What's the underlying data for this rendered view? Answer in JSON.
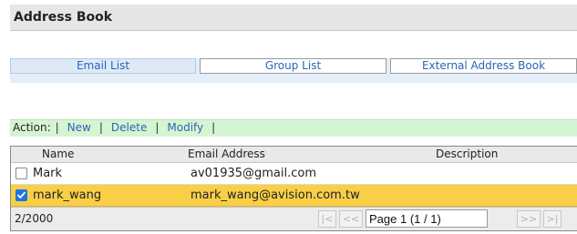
{
  "window": {
    "title": "Address Book"
  },
  "tabs": [
    {
      "label": "Email List",
      "active": true
    },
    {
      "label": "Group List",
      "active": false
    },
    {
      "label": "External Address Book",
      "active": false
    }
  ],
  "actions": {
    "label": "Action:",
    "new_label": "New",
    "delete_label": "Delete",
    "modify_label": "Modify"
  },
  "table": {
    "columns": [
      "Name",
      "Email Address",
      "Description"
    ],
    "rows": [
      {
        "name": "Mark",
        "email": "av01935@gmail.com",
        "description": "",
        "checked": false,
        "selected": false
      },
      {
        "name": "mark_wang",
        "email": "mark_wang@avision.com.tw",
        "description": "",
        "checked": true,
        "selected": true
      }
    ]
  },
  "pagination": {
    "count": "2/2000",
    "first": "|<",
    "prev": "<<",
    "page_value": "Page 1 (1 / 1)",
    "next": ">>",
    "last": ">|"
  },
  "colors": {
    "selected_row": "#f9cf47",
    "action_bar": "#d5f5d2",
    "tab_strip": "#e3eef9",
    "link": "#2d63b8",
    "checkbox": "#1e73e8"
  }
}
